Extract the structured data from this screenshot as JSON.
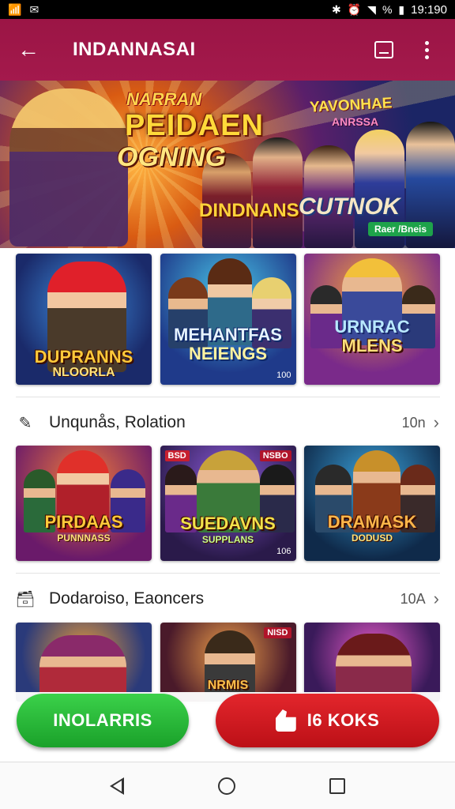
{
  "status_bar": {
    "left_icons": [
      "sim-icon",
      "mail-icon"
    ],
    "time": "19:190",
    "battery": "%"
  },
  "app_bar": {
    "title": "INDANNASAI",
    "back_icon": "arrow-left-icon",
    "action_icons": [
      "window-icon",
      "more-vert-icon"
    ]
  },
  "hero": {
    "brand": "NARRAN",
    "title": "PEIDAEN",
    "subtitle": "OGNING",
    "tag1": "YAVONHAE",
    "tag2": "ANRSSA",
    "tag3": "DINDNANS",
    "tag4": "CUTNOK",
    "tag5": "Raer /Bneis"
  },
  "row1": [
    {
      "title": "DUPRANNS",
      "subtitle": "NLOORLA",
      "badge": ""
    },
    {
      "title": "MEHANTFAS",
      "subtitle": "NEIENGS",
      "badge": "100"
    },
    {
      "title": "URNRAC",
      "subtitle": "MLENS",
      "badge": ""
    }
  ],
  "section1": {
    "icon": "edit-circle-icon",
    "title": "Unqunås, Rolation",
    "count": "10n",
    "chevron": "›"
  },
  "row2": [
    {
      "title": "PIRDAAS",
      "subtitle": "PUNNNASS",
      "badge": "",
      "tl_badge": ""
    },
    {
      "title": "SUEDAVNS",
      "subtitle": "SUPPLANS",
      "badge": "106",
      "tl_badge": "BSD",
      "tr_badge": "NSBO"
    },
    {
      "title": "DRAMASK",
      "subtitle": "DODUSD",
      "badge": ""
    }
  ],
  "section2": {
    "icon": "briefcase-icon",
    "title": "Dodaroiso, Eaoncers",
    "count": "10A",
    "chevron": "›"
  },
  "row3": [
    {
      "title": "",
      "badge": ""
    },
    {
      "title": "NRMIS",
      "badge": "",
      "tr_badge": "NISD"
    },
    {
      "title": "",
      "badge": ""
    }
  ],
  "actions": {
    "primary_label": "INOLARRIS",
    "secondary_label": "I6 KOKS",
    "secondary_icon": "hand-icon"
  },
  "nav_bar": {
    "icons": [
      "nav-back-icon",
      "nav-home-icon",
      "nav-recent-icon"
    ]
  },
  "colors": {
    "app_bar": "#a4194c",
    "primary_button": "#2bbd3a",
    "secondary_button": "#d31b22"
  }
}
